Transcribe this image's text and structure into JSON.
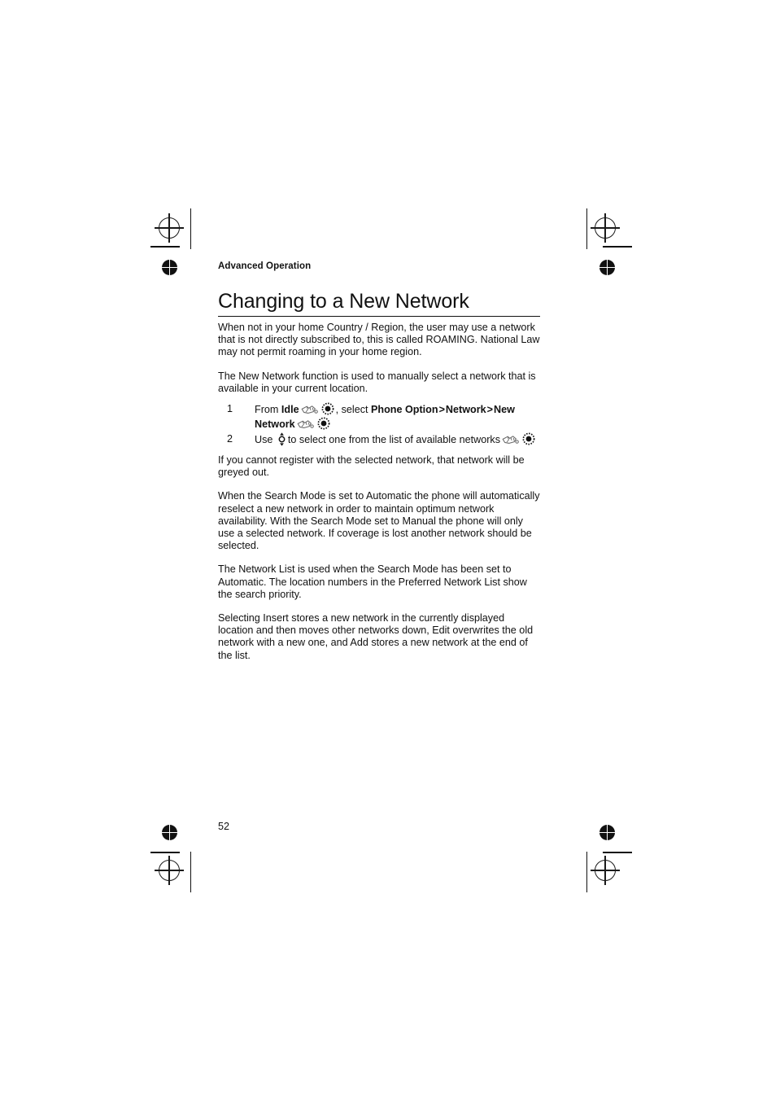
{
  "document": {
    "running_head": "Advanced Operation",
    "title": "Changing to a New Network",
    "page_number": "52"
  },
  "paragraphs": {
    "intro": "When not in your home Country / Region, the user may use a network that is not directly subscribed to, this is called ROAMING. National Law may not permit roaming in your home region.",
    "function_desc": "The New Network function is used to manually select a network that is available in your current location.",
    "greyed_out": "If you cannot register with the selected network, that network will be greyed out.",
    "search_mode": "When the Search Mode is set to Automatic the phone will automatically reselect a new network in order to maintain optimum network availability. With the Search Mode set to Manual the phone will only use a selected network. If coverage is lost another network should be selected.",
    "network_list": "The Network List is used when the Search Mode has been set to Automatic. The location numbers in the Preferred Network List show the search priority.",
    "insert_edit_add": "Selecting Insert stores a new network in the currently displayed location and then moves other networks down, Edit overwrites the old network with a new one, and Add stores a new network at the end of the list."
  },
  "steps": [
    {
      "number": "1",
      "text_1": "From",
      "bold_1": "Idle",
      "text_2": ", select",
      "bold_2": "Phone Option",
      "sep_1": ">",
      "bold_3": "Network",
      "sep_2": ">",
      "bold_4": "New Network"
    },
    {
      "number": "2",
      "text_1": "Use",
      "text_2": "to select one from the list of available networks"
    }
  ],
  "icons": {
    "soft_key": "soft-key-hand-icon",
    "select_key": "select-key-icon",
    "navigation_key": "navigation-key-icon"
  },
  "colors": {
    "ink": "#111111",
    "paper": "#ffffff"
  }
}
